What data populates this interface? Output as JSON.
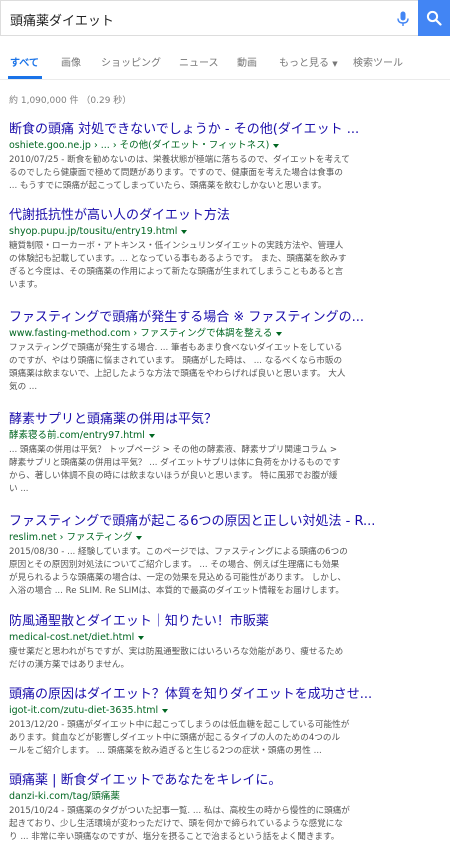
{
  "search": {
    "query": "頭痛薬ダイエット"
  },
  "tabs": [
    {
      "label": "すべて"
    },
    {
      "label": "画像"
    },
    {
      "label": "ショッピング"
    },
    {
      "label": "ニュース"
    },
    {
      "label": "動画"
    },
    {
      "label": "もっと見る"
    },
    {
      "label": "検索ツール"
    }
  ],
  "stats": "約 1,090,000 件 （0.29 秒）",
  "results": [
    {
      "title": "断食の頭痛 対処できないでしょうか - その他(ダイエット ...",
      "url": "oshiete.goo.ne.jp › ... › その他(ダイエット・フィットネス)",
      "snippet": [
        "2010/07/25 - 断食を勧めないのは、栄養状態が極端に落ちるので、ダイエットを考えて",
        "るのでしたら健康面で極めて問題があります。ですので、健康面を考えた場合は食事の",
        "... もうすでに頭痛が起こってしまっていたら、頭痛薬を飲むしかないと思います。"
      ]
    },
    {
      "title": "代謝抵抗性が高い人のダイエット方法",
      "url": "shyop.pupu.jp/tousitu/entry19.html",
      "snippet": [
        "糖質制限・ローカーボ・アトキンス・低インシュリンダイエットの実践方法や、管理人",
        "の体験記も記載しています。... となっている事もあるようです。 また、頭痛薬を飲みす",
        "ぎると今度は、その頭痛薬の作用によって新たな頭痛が生まれてしまうこともあると言",
        "います。"
      ]
    },
    {
      "title": "ファスティングで頭痛が発生する場合 ※ ファスティングの...",
      "url": "www.fasting-method.com › ファスティングで体調を整える",
      "snippet": [
        "ファスティングで頭痛が発生する場合. ... 筆者もあまり食べないダイエットをしている",
        "のですが、やはり頭痛に悩まされています。 頭痛がした時は、 ... なるべくなら市販の",
        "頭痛薬は飲まないで、上記したような方法で頭痛をやわらげれば良いと思います。 大人",
        "気の ..."
      ]
    },
    {
      "title": "酵素サプリと頭痛薬の併用は平気？",
      "url": "酵素寝る前.com/entry97.html",
      "snippet": [
        "... 頭痛薬の併用は平気？ トップページ > その他の酵素液、酵素サプリ関連コラム >",
        "酵素サプリと頭痛薬の併用は平気？ ... ダイエットサプリは体に負荷をかけるものです",
        "から、著しい体調不良の時には飲まないほうが良いと思います。 特に風邪でお腹が緩",
        "い ..."
      ]
    },
    {
      "title": "ファスティングで頭痛が起こる6つの原因と正しい対処法 - R...",
      "url": "reslim.net › ファスティング",
      "snippet": [
        "2015/08/30 - ... 経験しています。このページでは、ファスティングによる頭痛の6つの",
        "原因とその原因別対処法についてご紹介します。 ... その場合、例えば生理痛にも効果",
        "が見られるような頭痛薬の場合は、一定の効果を見込める可能性があります。 しかし、",
        "入浴の場合 ... Re SLIM. Re SLIMは、本質的で最高のダイエット情報をお届けします。"
      ]
    },
    {
      "title": "防風通聖散とダイエット｜知りたい！市販薬",
      "url": "medical-cost.net/diet.html",
      "snippet": [
        "痩せ薬だと思われがちですが、実は防風通聖散にはいろいろな効能があり、痩せるため",
        "だけの漢方薬ではありません。"
      ]
    },
    {
      "title": "頭痛の原因はダイエット？体質を知りダイエットを成功させ...",
      "url": "igot-it.com/zutu-diet-3635.html",
      "snippet": [
        "2013/12/20 - 頭痛がダイエット中に起こってしまうのは低血糖を起こしている可能性が",
        "あります。貧血などが影響しダイエット中に頭痛が起こるタイプの人のための4つのル",
        "ールをご紹介します。 ... 頭痛薬を飲み過ぎると生じる2つの症状・頭痛の男性 ..."
      ]
    },
    {
      "title": "頭痛薬 | 断食ダイエットであなたをキレイに。",
      "url": "danzi-ki.com/tag/頭痛薬",
      "snippet": [
        "2015/10/24 - 頭痛薬のタグがついた記事一覧. ... 私は、高校生の時から慢性的に頭痛が",
        "起きており、少し生活環境が変わっただけで、頭を何かで締られているような感覚にな",
        "り ... 非常に辛い頭痛なのですが、塩分を摂ることで治まるという話をよく聞きます。"
      ]
    }
  ]
}
